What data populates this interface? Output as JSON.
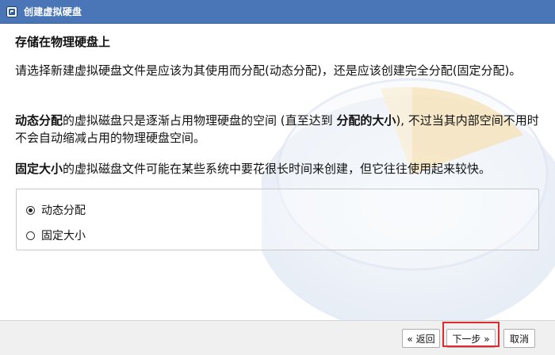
{
  "window": {
    "title": "创建虚拟硬盘",
    "accent_color": "#4a76b7"
  },
  "page": {
    "heading": "存储在物理硬盘上",
    "intro": "请选择新建虚拟硬盘文件是应该为其使用而分配(动态分配)，还是应该创建完全分配(固定分配)。",
    "dynamic_desc": {
      "term": "动态分配",
      "text_a": "的虚拟磁盘只是逐渐占用物理硬盘的空间 (直至达到 ",
      "emphasis": "分配的大小",
      "text_b": "), 不过当其内部空间不用时不会自动缩减占用的物理硬盘空间。"
    },
    "fixed_desc": {
      "term": "固定大小",
      "text": "的虚拟磁盘文件可能在某些系统中要花很长时间来创建，但它往往使用起来较快。"
    }
  },
  "options": {
    "selected": "动态分配",
    "items": [
      {
        "label": "动态分配",
        "checked": true
      },
      {
        "label": "固定大小",
        "checked": false
      }
    ]
  },
  "footer": {
    "back_label": "« 返回",
    "next_label": "下一步 »",
    "cancel_label": "取消",
    "highlight_color": "#e0282f"
  }
}
